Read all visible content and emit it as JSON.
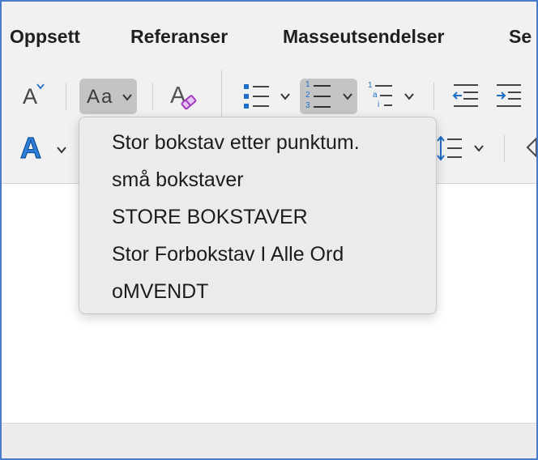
{
  "tabs": [
    "Oppsett",
    "Referanser",
    "Masseutsendelser",
    "Se"
  ],
  "toolbar": {
    "font_size_button": "A",
    "change_case_button": "Aa",
    "text_effects_button": "A",
    "number_list_digits": [
      "1",
      "2",
      "3"
    ],
    "multilevel_list_glyphs": [
      "1",
      "a",
      "i"
    ],
    "clear_formatting_glyph": "A"
  },
  "change_case_menu": {
    "items": [
      "Stor bokstav etter punktum.",
      "små bokstaver",
      "STORE BOKSTAVER",
      "Stor Forbokstav I Alle Ord",
      "oMVENDT"
    ]
  },
  "colors": {
    "accent_blue": "#1e6ec8",
    "eraser_purple": "#a23bbf",
    "pressed_bg": "#c4c4c4",
    "frame_border": "#4a7bc8"
  },
  "icons": [
    "font-size-icon",
    "change-case-icon",
    "clear-formatting-icon",
    "bullet-list-icon",
    "numbered-list-icon",
    "multilevel-list-icon",
    "decrease-indent-icon",
    "increase-indent-icon",
    "text-effects-icon",
    "line-spacing-icon",
    "shape-icon"
  ]
}
